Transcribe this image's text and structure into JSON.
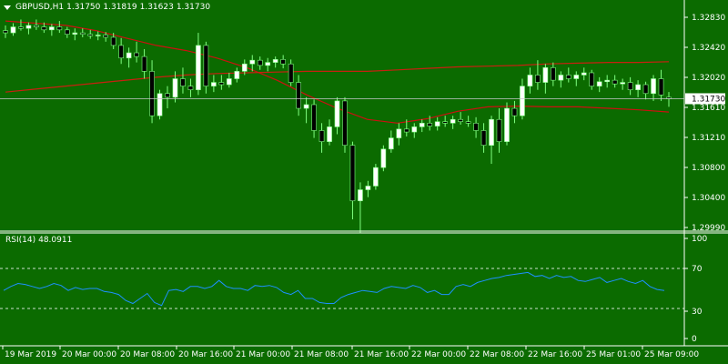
{
  "header": {
    "symbol": "GBPUSD,H1",
    "open": "1.31750",
    "high": "1.31819",
    "low": "1.31623",
    "close": "1.31730"
  },
  "rsi_header": {
    "label": "RSI(14)",
    "value": "48.0911"
  },
  "colors": {
    "background": "#0b6b00",
    "grid": "#ffffff",
    "bull": "#ffffff",
    "bear": "#000000",
    "wick": "#80ff80",
    "ma_fast": "#cc1010",
    "ma_slow": "#c82010",
    "rsi_line": "#1e90ff",
    "bid_line": "#c8c8c8"
  },
  "chart_data": [
    {
      "type": "candlestick",
      "title": "GBPUSD,H1",
      "y_ticks": [
        "1.32830",
        "1.32420",
        "1.32020",
        "1.31610",
        "1.31210",
        "1.30800",
        "1.30400",
        "1.29990"
      ],
      "ylim": [
        1.2999,
        1.3283
      ],
      "current_price": "1.31730",
      "x_ticks": [
        "19 Mar 2019",
        "20 Mar 00:00",
        "20 Mar 08:00",
        "20 Mar 16:00",
        "21 Mar 00:00",
        "21 Mar 08:00",
        "21 Mar 16:00",
        "22 Mar 00:00",
        "22 Mar 08:00",
        "22 Mar 16:00",
        "25 Mar 01:00",
        "25 Mar 09:00"
      ],
      "ohlc": [
        [
          1.3265,
          1.3272,
          1.3255,
          1.3262
        ],
        [
          1.3262,
          1.3275,
          1.3258,
          1.327
        ],
        [
          1.327,
          1.328,
          1.3265,
          1.3268
        ],
        [
          1.3268,
          1.3276,
          1.326,
          1.3272
        ],
        [
          1.3272,
          1.328,
          1.3266,
          1.327
        ],
        [
          1.327,
          1.3276,
          1.3262,
          1.3266
        ],
        [
          1.3266,
          1.3274,
          1.3258,
          1.327
        ],
        [
          1.327,
          1.3278,
          1.3262,
          1.3266
        ],
        [
          1.3266,
          1.327,
          1.3255,
          1.326
        ],
        [
          1.326,
          1.3268,
          1.3252,
          1.3262
        ],
        [
          1.3262,
          1.3268,
          1.3256,
          1.326
        ],
        [
          1.326,
          1.3266,
          1.3254,
          1.3258
        ],
        [
          1.3258,
          1.3264,
          1.3252,
          1.3259
        ],
        [
          1.3259,
          1.3263,
          1.325,
          1.3256
        ],
        [
          1.3256,
          1.3262,
          1.324,
          1.3245
        ],
        [
          1.3245,
          1.3255,
          1.322,
          1.3228
        ],
        [
          1.3228,
          1.3242,
          1.3215,
          1.3235
        ],
        [
          1.3235,
          1.325,
          1.3222,
          1.323
        ],
        [
          1.323,
          1.324,
          1.32,
          1.321
        ],
        [
          1.321,
          1.3225,
          1.314,
          1.315
        ],
        [
          1.315,
          1.3185,
          1.3145,
          1.318
        ],
        [
          1.318,
          1.319,
          1.316,
          1.3175
        ],
        [
          1.3175,
          1.321,
          1.3168,
          1.32
        ],
        [
          1.32,
          1.3215,
          1.318,
          1.319
        ],
        [
          1.319,
          1.32,
          1.3175,
          1.3185
        ],
        [
          1.3185,
          1.3262,
          1.3178,
          1.3245
        ],
        [
          1.3245,
          1.325,
          1.318,
          1.319
        ],
        [
          1.319,
          1.3205,
          1.3182,
          1.3195
        ],
        [
          1.3195,
          1.3205,
          1.3185,
          1.3192
        ],
        [
          1.3192,
          1.3208,
          1.3188,
          1.32
        ],
        [
          1.32,
          1.3215,
          1.3195,
          1.321
        ],
        [
          1.321,
          1.3226,
          1.3205,
          1.322
        ],
        [
          1.322,
          1.3232,
          1.321,
          1.3225
        ],
        [
          1.3225,
          1.323,
          1.3212,
          1.3218
        ],
        [
          1.3218,
          1.3228,
          1.321,
          1.3222
        ],
        [
          1.3222,
          1.323,
          1.3215,
          1.3226
        ],
        [
          1.3226,
          1.3232,
          1.3214,
          1.322
        ],
        [
          1.322,
          1.3226,
          1.319,
          1.3195
        ],
        [
          1.3195,
          1.3205,
          1.315,
          1.316
        ],
        [
          1.316,
          1.3175,
          1.314,
          1.3165
        ],
        [
          1.3165,
          1.3172,
          1.312,
          1.313
        ],
        [
          1.313,
          1.314,
          1.31,
          1.3115
        ],
        [
          1.3115,
          1.3145,
          1.311,
          1.3135
        ],
        [
          1.3135,
          1.3175,
          1.3125,
          1.317
        ],
        [
          1.317,
          1.3175,
          1.31,
          1.311
        ],
        [
          1.311,
          1.3115,
          1.301,
          1.3035
        ],
        [
          1.3035,
          1.306,
          1.2992,
          1.305
        ],
        [
          1.305,
          1.3062,
          1.304,
          1.3055
        ],
        [
          1.3055,
          1.3085,
          1.305,
          1.308
        ],
        [
          1.308,
          1.311,
          1.3075,
          1.3105
        ],
        [
          1.3105,
          1.313,
          1.31,
          1.312
        ],
        [
          1.312,
          1.314,
          1.311,
          1.3132
        ],
        [
          1.3132,
          1.3145,
          1.3122,
          1.3128
        ],
        [
          1.3128,
          1.314,
          1.312,
          1.3135
        ],
        [
          1.3135,
          1.3145,
          1.3128,
          1.314
        ],
        [
          1.314,
          1.315,
          1.313,
          1.3136
        ],
        [
          1.3136,
          1.3148,
          1.313,
          1.3142
        ],
        [
          1.3142,
          1.315,
          1.3135,
          1.314
        ],
        [
          1.314,
          1.315,
          1.3132,
          1.3145
        ],
        [
          1.3145,
          1.3155,
          1.3138,
          1.3142
        ],
        [
          1.3142,
          1.315,
          1.3135,
          1.314
        ],
        [
          1.314,
          1.3148,
          1.312,
          1.313
        ],
        [
          1.313,
          1.314,
          1.31,
          1.311
        ],
        [
          1.311,
          1.315,
          1.3085,
          1.3145
        ],
        [
          1.3145,
          1.316,
          1.31,
          1.3115
        ],
        [
          1.3115,
          1.3168,
          1.311,
          1.316
        ],
        [
          1.316,
          1.317,
          1.314,
          1.315
        ],
        [
          1.315,
          1.32,
          1.3145,
          1.319
        ],
        [
          1.319,
          1.3215,
          1.318,
          1.3205
        ],
        [
          1.3205,
          1.3225,
          1.3185,
          1.3195
        ],
        [
          1.3195,
          1.322,
          1.318,
          1.3215
        ],
        [
          1.3215,
          1.3222,
          1.319,
          1.3198
        ],
        [
          1.3198,
          1.321,
          1.3188,
          1.3205
        ],
        [
          1.3205,
          1.3215,
          1.3195,
          1.32
        ],
        [
          1.32,
          1.321,
          1.319,
          1.3205
        ],
        [
          1.3205,
          1.3215,
          1.3198,
          1.3208
        ],
        [
          1.3208,
          1.3212,
          1.3185,
          1.319
        ],
        [
          1.319,
          1.3202,
          1.3182,
          1.3196
        ],
        [
          1.3196,
          1.3205,
          1.3188,
          1.3198
        ],
        [
          1.3198,
          1.3205,
          1.3188,
          1.3193
        ],
        [
          1.3193,
          1.32,
          1.3185,
          1.3195
        ],
        [
          1.3195,
          1.3202,
          1.3178,
          1.3185
        ],
        [
          1.3185,
          1.3198,
          1.3175,
          1.3192
        ],
        [
          1.3192,
          1.3196,
          1.3172,
          1.318
        ],
        [
          1.318,
          1.3205,
          1.317,
          1.32
        ],
        [
          1.32,
          1.3212,
          1.317,
          1.3178
        ],
        [
          1.3175,
          1.3182,
          1.3162,
          1.3173
        ]
      ],
      "ma_fast": [
        1.3278,
        1.3275,
        1.3272,
        1.3265,
        1.3255,
        1.3245,
        1.3238,
        1.3228,
        1.3215,
        1.3198,
        1.3178,
        1.316,
        1.3145,
        1.314,
        1.3146,
        1.3156,
        1.3162,
        1.3163,
        1.3162,
        1.3162,
        1.316,
        1.3158,
        1.3155
      ],
      "ma_slow": [
        1.3182,
        1.3186,
        1.319,
        1.3194,
        1.3198,
        1.3202,
        1.3205,
        1.3207,
        1.3208,
        1.3209,
        1.321,
        1.321,
        1.321,
        1.3212,
        1.3214,
        1.3216,
        1.3217,
        1.3218,
        1.322,
        1.3221,
        1.3222,
        1.3222,
        1.3223
      ]
    },
    {
      "type": "line",
      "title": "RSI(14) 48.0911",
      "y_ticks": [
        "100",
        "70",
        "30",
        "0"
      ],
      "ylim": [
        0,
        100
      ],
      "levels": [
        70,
        30
      ],
      "rsi": [
        48,
        52,
        55,
        54,
        52,
        50,
        52,
        55,
        53,
        48,
        51,
        49,
        50,
        50,
        47,
        46,
        44,
        38,
        35,
        40,
        45,
        36,
        33,
        48,
        49,
        47,
        52,
        52,
        50,
        52,
        58,
        52,
        50,
        50,
        48,
        53,
        52,
        53,
        51,
        46,
        44,
        48,
        40,
        40,
        36,
        35,
        35,
        41,
        44,
        46,
        48,
        47,
        46,
        50,
        52,
        51,
        50,
        53,
        51,
        46,
        48,
        44,
        44,
        52,
        54,
        52,
        56,
        58,
        60,
        61,
        63,
        64,
        65,
        66,
        62,
        63,
        60,
        63,
        61,
        62,
        58,
        57,
        59,
        61,
        56,
        58,
        60,
        57,
        55,
        58,
        52,
        49,
        48
      ]
    }
  ]
}
